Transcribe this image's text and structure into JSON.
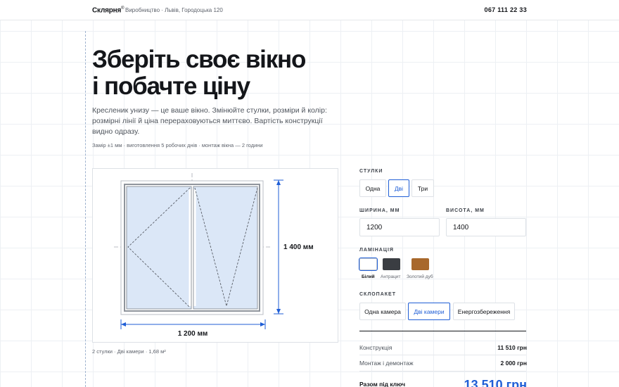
{
  "header": {
    "brand": "Склярня",
    "brand_mark": "®",
    "address": "Виробництво · Львів, Городоцька 120",
    "phone": "067 111 22 33"
  },
  "hero": {
    "title_line1": "Зберіть своє вікно",
    "title_line2": "і побачте ціну",
    "lead": "Кресленик унизу — це ваше вікно. Змінюйте стулки, розміри й колір: розмірні лінії й ціна перераховуються миттєво. Вартість конструкції видно одразу.",
    "meta": "Замір ±1 мм · виготовлення 5 робочих днів · монтаж вікна — 2 години"
  },
  "drawing": {
    "width_label": "1 200 мм",
    "height_label": "1 400 мм",
    "width_mm": 1200,
    "height_mm": 1400,
    "sashes": 2,
    "frame_color": "#ffffff",
    "glass_color": "#dbe7f7",
    "dimension_color": "#1f5ed6",
    "spec": "2 стулки · Дві камери · 1,68 м²"
  },
  "config": {
    "sashes_label": "Стулки",
    "sashes_options": [
      "Одна",
      "Дві",
      "Три"
    ],
    "sashes_selected": "Дві",
    "width_label": "Ширина, мм",
    "width_value": "1200",
    "height_label": "Висота, мм",
    "height_value": "1400",
    "lamination_label": "Ламінація",
    "lamination_options": [
      {
        "name": "Білий",
        "color": "#ffffff"
      },
      {
        "name": "Антрацит",
        "color": "#3a3d42"
      },
      {
        "name": "Золотий дуб",
        "color": "#a8682c"
      }
    ],
    "lamination_selected": "Білий",
    "glass_label": "Склопакет",
    "glass_options": [
      "Одна камера",
      "Дві камери",
      "Енергозбереження"
    ],
    "glass_selected": "Дві камери"
  },
  "price": {
    "construction_label": "Конструкція",
    "construction_value": "11 510 грн",
    "install_label": "Монтаж і демонтаж",
    "install_value": "2 000 грн",
    "total_label": "Разом під ключ",
    "total_value": "13 510 грн"
  },
  "colors": {
    "accent": "#1f5ed6",
    "text": "#14161a",
    "grid": "#edf0f4"
  }
}
